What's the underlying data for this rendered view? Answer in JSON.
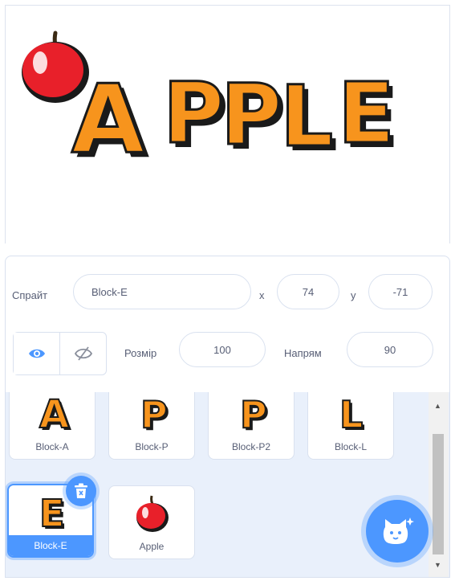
{
  "stage": {
    "title_text": "APPLE"
  },
  "sprite_info": {
    "sprite_label": "Спрайт",
    "sprite_name": "Block-E",
    "x_label": "x",
    "x_value": "74",
    "y_label": "y",
    "y_value": "-71",
    "show_label": "",
    "size_label": "Розмір",
    "size_value": "100",
    "direction_label": "Напрям",
    "direction_value": "90"
  },
  "sprites": [
    {
      "name": "Block-A",
      "glyph": "A",
      "selected": false
    },
    {
      "name": "Block-P",
      "glyph": "P",
      "selected": false
    },
    {
      "name": "Block-P2",
      "glyph": "P",
      "selected": false
    },
    {
      "name": "Block-L",
      "glyph": "L",
      "selected": false
    },
    {
      "name": "Block-E",
      "glyph": "E",
      "selected": true
    },
    {
      "name": "Apple",
      "glyph": "apple",
      "selected": false
    }
  ],
  "colors": {
    "accent": "#4c97ff",
    "letter_fill": "#f7941d",
    "letter_shadow": "#1a1a1a",
    "apple_red": "#e8202a"
  },
  "icons": {
    "show": "eye-icon",
    "hide": "eye-slash-icon",
    "delete": "trash-icon",
    "add_sprite": "cat-sparkle-icon"
  }
}
